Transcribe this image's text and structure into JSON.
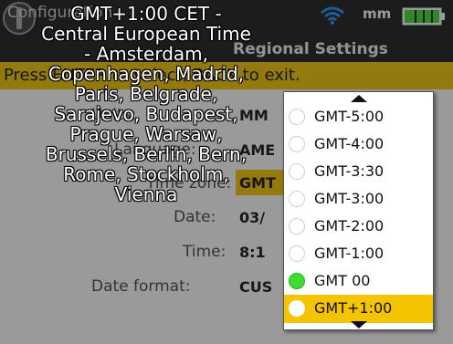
{
  "header": {
    "screen_title": "Configuration",
    "unit": "mm",
    "wifi_icon": "wifi-icon",
    "battery_icon": "battery-full-icon",
    "subheader_title": "Regional Settings"
  },
  "hint": "Press ENTER to select, BACK to exit.",
  "form": {
    "labels": {
      "units": "Units:",
      "language": "Language:",
      "timezone": "Time zone:",
      "date": "Date:",
      "time": "Time:",
      "date_format": "Date format:"
    },
    "values": {
      "units": "MM",
      "language": "AME",
      "timezone": "GMT",
      "date": "03/",
      "time": "8:1",
      "date_format": "CUS"
    }
  },
  "timezone_description": "GMT+1:00 CET - Central European Time - Amsterdam, Copenhagen, Madrid, Paris, Belgrade, Sarajevo, Budapest, Prague, Warsaw, Brussels, Berlin, Bern, Rome, Stockholm, Vienna",
  "timezone_list": {
    "items": [
      {
        "label": "GMT-5:00"
      },
      {
        "label": "GMT-4:00"
      },
      {
        "label": "GMT-3:30"
      },
      {
        "label": "GMT-3:00"
      },
      {
        "label": "GMT-2:00"
      },
      {
        "label": "GMT-1:00"
      },
      {
        "label": "GMT 00"
      },
      {
        "label": "GMT+1:00"
      }
    ],
    "active_index": 6,
    "selected_index": 7,
    "scroll_up_icon": "scroll-up-icon",
    "scroll_down_icon": "scroll-down-icon"
  },
  "colors": {
    "highlight": "#f5c400",
    "active_radio": "#3ddc2f",
    "header_bg": "#1a1a1a",
    "wifi": "#1e90ff",
    "battery": "#3ddc2f"
  }
}
